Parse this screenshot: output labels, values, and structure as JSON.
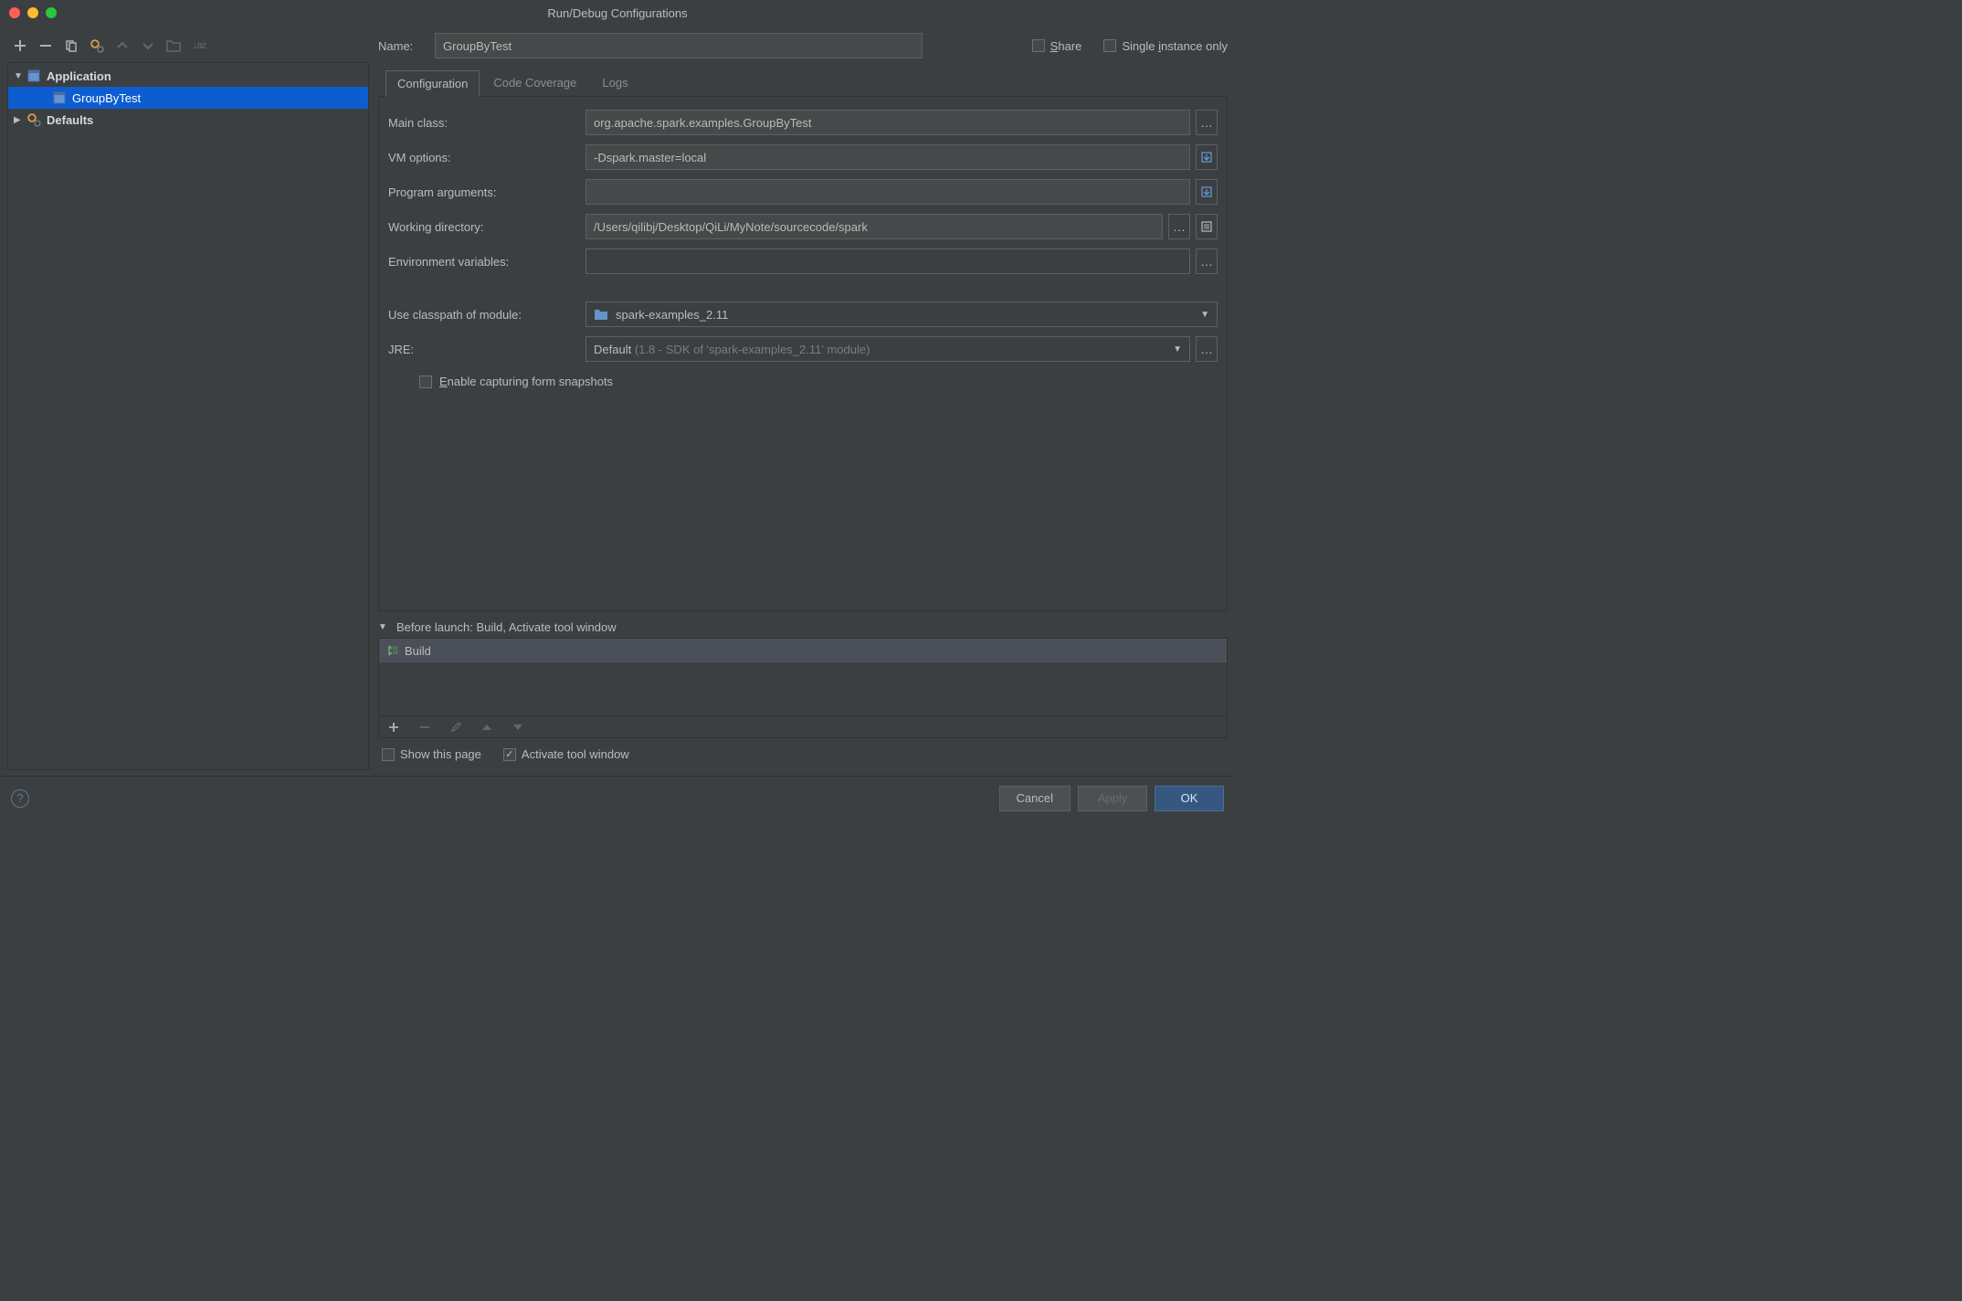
{
  "window": {
    "title": "Run/Debug Configurations"
  },
  "nameRow": {
    "label": "Name:",
    "value": "GroupByTest"
  },
  "topChecks": {
    "share": "Share",
    "single": "Single instance only"
  },
  "tree": {
    "root1": "Application",
    "child1": "GroupByTest",
    "root2": "Defaults"
  },
  "tabs": {
    "t1": "Configuration",
    "t2": "Code Coverage",
    "t3": "Logs"
  },
  "form": {
    "mainclass_label": "Main class:",
    "mainclass": "org.apache.spark.examples.GroupByTest",
    "vmopt_label": "VM options:",
    "vmopt": "-Dspark.master=local",
    "progargs_label": "Program arguments:",
    "progargs": "",
    "workdir_label": "Working directory:",
    "workdir": "/Users/qilibj/Desktop/QiLi/MyNote/sourcecode/spark",
    "envvars_label": "Environment variables:",
    "envvars": "",
    "classpath_label": "Use classpath of module:",
    "classpath": "spark-examples_2.11",
    "jre_label": "JRE:",
    "jre_main": "Default ",
    "jre_detail": "(1.8 - SDK of 'spark-examples_2.11' module)",
    "enable_snapshots": "Enable capturing form snapshots"
  },
  "before_launch": {
    "header": "Before launch: Build, Activate tool window",
    "item": "Build"
  },
  "bottom_checks": {
    "show": "Show this page",
    "activate": "Activate tool window"
  },
  "footer": {
    "cancel": "Cancel",
    "apply": "Apply",
    "ok": "OK"
  }
}
